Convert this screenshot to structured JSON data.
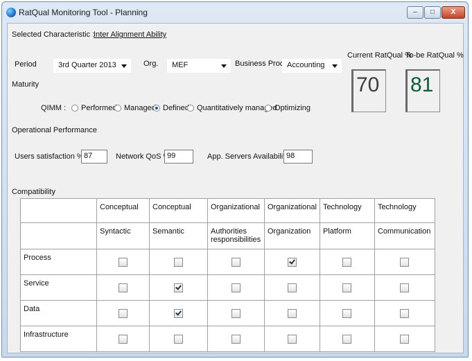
{
  "window": {
    "title": "RatQual Monitoring Tool - Planning",
    "controls": {
      "min": "–",
      "max": "□",
      "close": "X"
    }
  },
  "selected": {
    "label": "Selected Characteristic :",
    "value": "Inter Alignment Ability"
  },
  "period": {
    "label": "Period",
    "value": "3rd Quarter 2013"
  },
  "org": {
    "label": "Org.",
    "value": "MEF"
  },
  "business_process": {
    "label": "Business Process",
    "value": "Accounting"
  },
  "current": {
    "label": "Current RatQual %",
    "value": "70"
  },
  "tobe": {
    "label": "To-be RatQual %",
    "value": "81"
  },
  "maturity": {
    "label": "Maturity",
    "qimm_label": "QIMM :",
    "options": [
      {
        "label": "Performed",
        "checked": false
      },
      {
        "label": "Managed",
        "checked": false
      },
      {
        "label": "Defined",
        "checked": true
      },
      {
        "label": "Quantitatively managed",
        "checked": false
      },
      {
        "label": "Optimizing",
        "checked": false
      }
    ]
  },
  "operational": {
    "label": "Operational Performance",
    "users_label": "Users satisfaction %",
    "users_value": "87",
    "network_label": "Network QoS %",
    "network_value": "99",
    "app_label": "App. Servers Availability %",
    "app_value": "98"
  },
  "compat": {
    "label": "Compatibility",
    "groups": [
      "Conceptual",
      "Conceptual",
      "Organizational",
      "Organizational",
      "Technology",
      "Technology"
    ],
    "sub": [
      "Syntactic",
      "Semantic",
      "Authorities responsibilities",
      "Organization",
      "Platform",
      "Communication"
    ],
    "rows": [
      {
        "name": "Process",
        "checks": [
          false,
          false,
          false,
          true,
          false,
          false
        ]
      },
      {
        "name": "Service",
        "checks": [
          false,
          true,
          false,
          false,
          false,
          false
        ]
      },
      {
        "name": "Data",
        "checks": [
          false,
          true,
          false,
          false,
          false,
          false
        ]
      },
      {
        "name": "Infrastructure",
        "checks": [
          false,
          false,
          false,
          false,
          false,
          false
        ]
      }
    ]
  }
}
